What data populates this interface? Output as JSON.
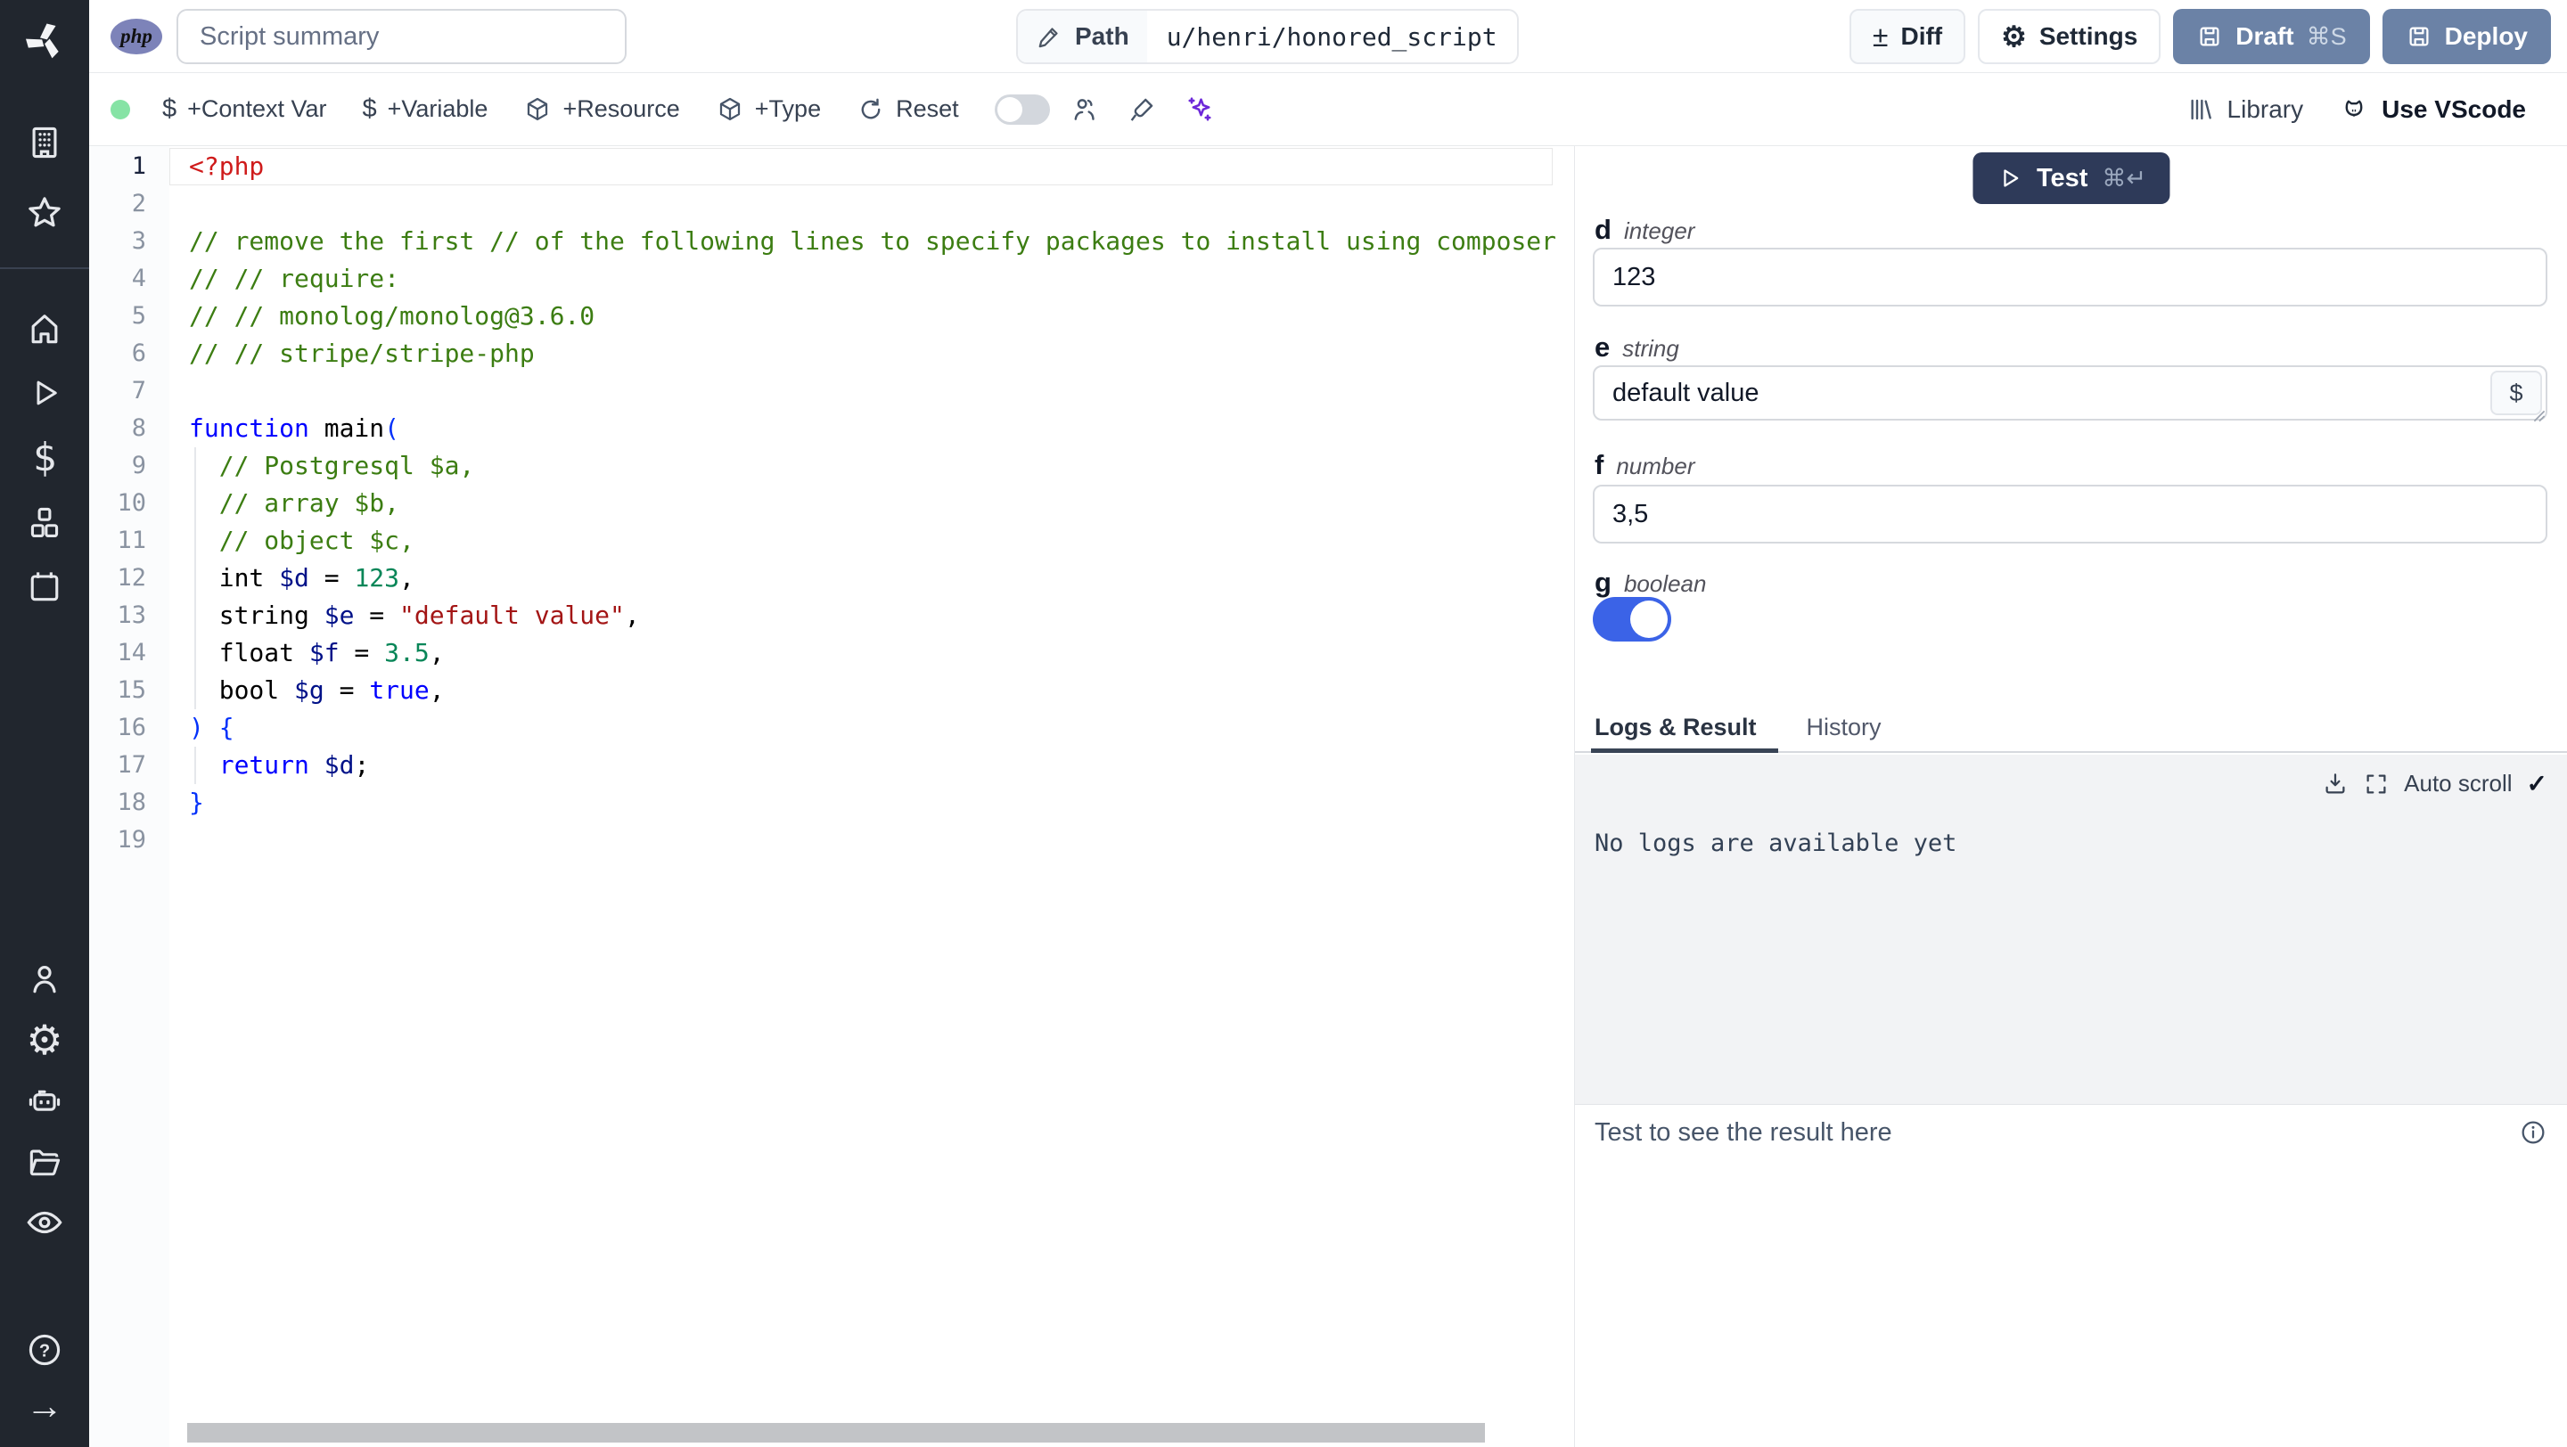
{
  "topbar": {
    "language_badge": "php",
    "summary_placeholder": "Script summary",
    "path_label": "Path",
    "path_value": "u/henri/honored_script",
    "diff_label": "Diff",
    "settings_label": "Settings",
    "draft_label": "Draft",
    "draft_shortcut": "⌘S",
    "deploy_label": "Deploy"
  },
  "toolbar": {
    "add_context_var": "+Context Var",
    "add_variable": "+Variable",
    "add_resource": "+Resource",
    "add_type": "+Type",
    "reset_label": "Reset",
    "library_label": "Library",
    "use_vscode_label": "Use VScode"
  },
  "icons": {
    "diff_glyph": "±",
    "dollar_glyph": "$",
    "gear_glyph": "⚙",
    "check_glyph": "✓",
    "arrow_right_glyph": "→",
    "sidebar_names": [
      "windmill-logo",
      "building",
      "star",
      "home",
      "play",
      "dollar",
      "cubes",
      "calendar",
      "user",
      "settings",
      "robot",
      "folder",
      "eye",
      "help",
      "arrow-right"
    ]
  },
  "editor": {
    "active_line": 1,
    "lines": [
      [
        [
          "<?php",
          "m"
        ]
      ],
      [],
      [
        [
          "// remove the first // of the following lines to specify packages to install using composer",
          "c"
        ]
      ],
      [
        [
          "// // require:",
          "c"
        ]
      ],
      [
        [
          "// // monolog/monolog@3.6.0",
          "c"
        ]
      ],
      [
        [
          "// // stripe/stripe-php",
          "c"
        ]
      ],
      [],
      [
        [
          "function",
          "k"
        ],
        [
          " main",
          "t"
        ],
        [
          "(",
          "p"
        ]
      ],
      [
        [
          "  // Postgresql $a,",
          "c"
        ]
      ],
      [
        [
          "  // array $b,",
          "c"
        ]
      ],
      [
        [
          "  // object $c,",
          "c"
        ]
      ],
      [
        [
          "  int ",
          "t"
        ],
        [
          "$d",
          "v"
        ],
        [
          " = ",
          "t"
        ],
        [
          "123",
          "n"
        ],
        [
          ",",
          "t"
        ]
      ],
      [
        [
          "  string ",
          "t"
        ],
        [
          "$e",
          "v"
        ],
        [
          " = ",
          "t"
        ],
        [
          "\"default value\"",
          "s"
        ],
        [
          ",",
          "t"
        ]
      ],
      [
        [
          "  float ",
          "t"
        ],
        [
          "$f",
          "v"
        ],
        [
          " = ",
          "t"
        ],
        [
          "3.5",
          "n"
        ],
        [
          ",",
          "t"
        ]
      ],
      [
        [
          "  bool ",
          "t"
        ],
        [
          "$g",
          "v"
        ],
        [
          " = ",
          "t"
        ],
        [
          "true",
          "k"
        ],
        [
          ",",
          "t"
        ]
      ],
      [
        [
          ") {",
          "p"
        ]
      ],
      [
        [
          "  ",
          "t"
        ],
        [
          "return",
          "k"
        ],
        [
          " ",
          "t"
        ],
        [
          "$d",
          "v"
        ],
        [
          ";",
          "t"
        ]
      ],
      [
        [
          "}",
          "p"
        ]
      ],
      []
    ]
  },
  "right_panel": {
    "test_label": "Test",
    "test_shortcut": "⌘↵",
    "params": [
      {
        "name": "d",
        "type": "integer",
        "value": "123",
        "widget": "input"
      },
      {
        "name": "e",
        "type": "string",
        "value": "default value",
        "widget": "input_dollar",
        "dollar_label": "$"
      },
      {
        "name": "f",
        "type": "number",
        "value": "3,5",
        "widget": "input"
      },
      {
        "name": "g",
        "type": "boolean",
        "value": true,
        "widget": "toggle"
      }
    ],
    "tabs": [
      {
        "label": "Logs & Result",
        "active": true
      },
      {
        "label": "History",
        "active": false
      }
    ],
    "logs": {
      "auto_scroll_label": "Auto scroll",
      "empty_message": "No logs are available yet"
    },
    "result_placeholder": "Test to see the result here"
  },
  "colors": {
    "accent_blue": "#3b63e7",
    "button_slate": "#6b82a6",
    "test_navy": "#2e3a59",
    "ai_purple": "#6d28d9",
    "online_green": "#86e3a5",
    "sidebar_bg": "#21262e"
  }
}
